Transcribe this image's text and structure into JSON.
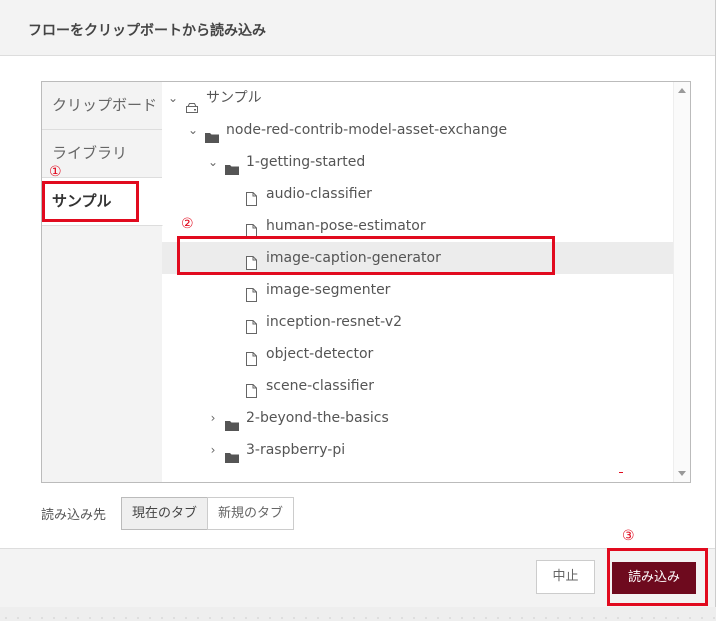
{
  "dialog": {
    "title": "フローをクリップボートから読み込み"
  },
  "tabs": [
    {
      "label": "クリップボード"
    },
    {
      "label": "ライブラリ"
    },
    {
      "label": "サンプル"
    }
  ],
  "tree": {
    "root": {
      "label": "サンプル",
      "icon": "drive-icon",
      "expanded": true
    },
    "package": {
      "label": "node-red-contrib-model-asset-exchange",
      "icon": "folder-icon",
      "expanded": true
    },
    "folders": [
      {
        "label": "1-getting-started",
        "expanded": true,
        "files": [
          {
            "label": "audio-classifier"
          },
          {
            "label": "human-pose-estimator"
          },
          {
            "label": "image-caption-generator",
            "selected": true
          },
          {
            "label": "image-segmenter"
          },
          {
            "label": "inception-resnet-v2"
          },
          {
            "label": "object-detector"
          },
          {
            "label": "scene-classifier"
          }
        ]
      },
      {
        "label": "2-beyond-the-basics",
        "expanded": false
      },
      {
        "label": "3-raspberry-pi",
        "expanded": false
      }
    ]
  },
  "destination": {
    "label": "読み込み先",
    "options": [
      "現在のタブ",
      "新規のタブ"
    ],
    "selected": "現在のタブ"
  },
  "footer": {
    "cancel_label": "中止",
    "import_label": "読み込み"
  },
  "annotations": {
    "step1": "①",
    "step2": "②",
    "step3": "③"
  },
  "colors": {
    "accent": "#6e0a1e",
    "highlight": "#e10a1e"
  }
}
